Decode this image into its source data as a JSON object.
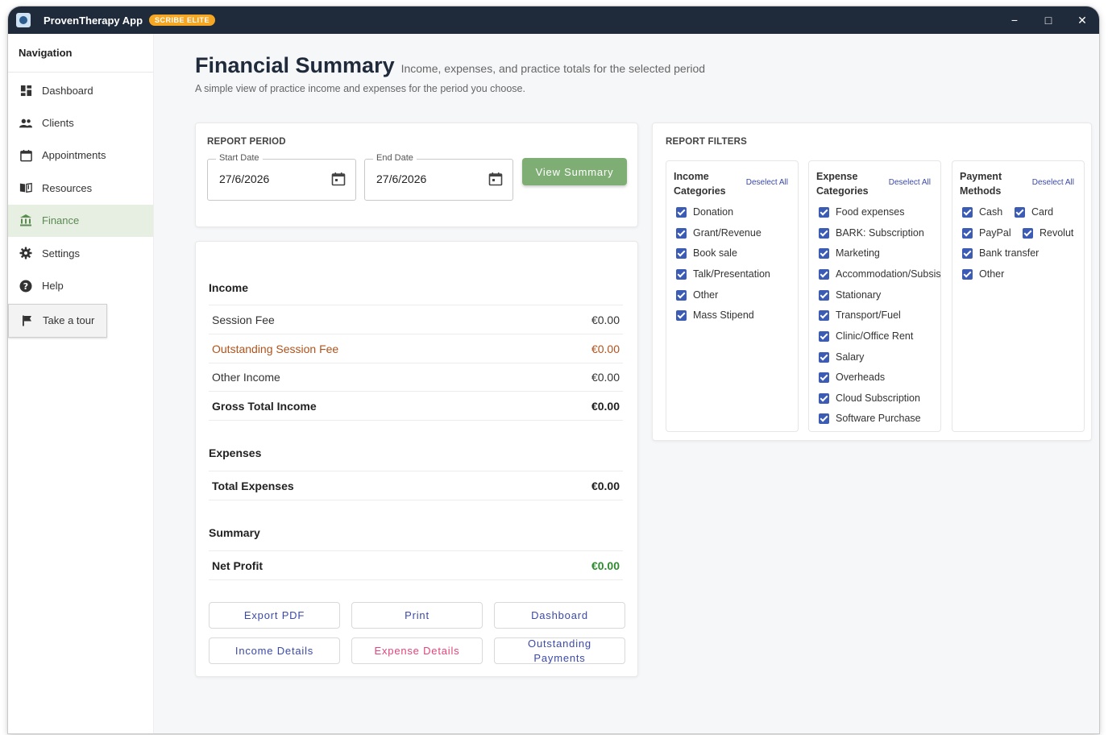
{
  "app": {
    "title": "ProvenTherapy App",
    "badge": "SCRIBE ELITE",
    "controls": [
      "−",
      "□",
      "✕"
    ]
  },
  "sidebar": {
    "title": "Navigation",
    "items": [
      {
        "label": "Dashboard",
        "icon": "dashboard-icon"
      },
      {
        "label": "Clients",
        "icon": "people-icon"
      },
      {
        "label": "Appointments",
        "icon": "calendar-icon"
      },
      {
        "label": "Resources",
        "icon": "book-icon"
      },
      {
        "label": "Finance",
        "icon": "bank-icon",
        "active": true
      },
      {
        "label": "Settings",
        "icon": "gear-icon"
      },
      {
        "label": "Help",
        "icon": "help-icon"
      }
    ],
    "tour_label": "Take a tour"
  },
  "header": {
    "title": "Financial Summary",
    "subtitle": "Income, expenses, and practice totals for the selected period",
    "description": "A simple view of practice income and expenses for the period you choose."
  },
  "report_period": {
    "label": "REPORT PERIOD",
    "start_label": "Start Date",
    "start_value": "27/6/2026",
    "end_label": "End Date",
    "end_value": "27/6/2026",
    "view_button": "View Summary"
  },
  "financials": {
    "income_heading": "Income",
    "income_rows": [
      {
        "label": "Session Fee",
        "value": "€0.00"
      },
      {
        "label": "Outstanding Session Fee",
        "value": "€0.00"
      },
      {
        "label": "Other Income",
        "value": "€0.00"
      },
      {
        "label": "Gross Total Income",
        "value": "€0.00"
      }
    ],
    "expenses_heading": "Expenses",
    "expense_rows": [
      {
        "label": "Total Expenses",
        "value": "€0.00"
      }
    ],
    "summary_heading": "Summary",
    "summary_rows": [
      {
        "label": "Net Profit",
        "value": "€0.00"
      }
    ]
  },
  "actions": {
    "export_pdf": "Export PDF",
    "print": "Print",
    "dashboard": "Dashboard",
    "income_details": "Income Details",
    "expense_details": "Expense Details",
    "outstanding_line1": "Outstanding",
    "outstanding_line2": "Payments"
  },
  "filters": {
    "label": "REPORT FILTERS",
    "deselect_label": "Deselect All",
    "income": {
      "title_line1": "Income",
      "title_line2": "Categories",
      "items": [
        "Donation",
        "Grant/Revenue",
        "Book sale",
        "Talk/Presentation",
        "Other",
        "Mass Stipend"
      ]
    },
    "expense": {
      "title_line1": "Expense",
      "title_line2": "Categories",
      "items": [
        "Food expenses",
        "BARK: Subscription",
        "Marketing",
        "Accommodation/Subsistence",
        "Stationary",
        "Transport/Fuel",
        "Clinic/Office Rent",
        "Salary",
        "Overheads",
        "Cloud Subscription",
        "Software Purchase"
      ]
    },
    "payment": {
      "title_line1": "Payment",
      "title_line2": "Methods",
      "items": [
        "Cash",
        "Card",
        "PayPal",
        "Revolut",
        "Bank transfer",
        "Other"
      ]
    }
  },
  "colors": {
    "titlebar": "#1f2a3b",
    "accent_green": "#7fae75",
    "active_nav_bg": "#e7efe3",
    "checkbox": "#3b5bb5",
    "link_blue": "#3b4aa8",
    "outstanding": "#b0521a",
    "profit": "#2e8b2e",
    "pink": "#e0457b",
    "badge": "#f5a623"
  }
}
